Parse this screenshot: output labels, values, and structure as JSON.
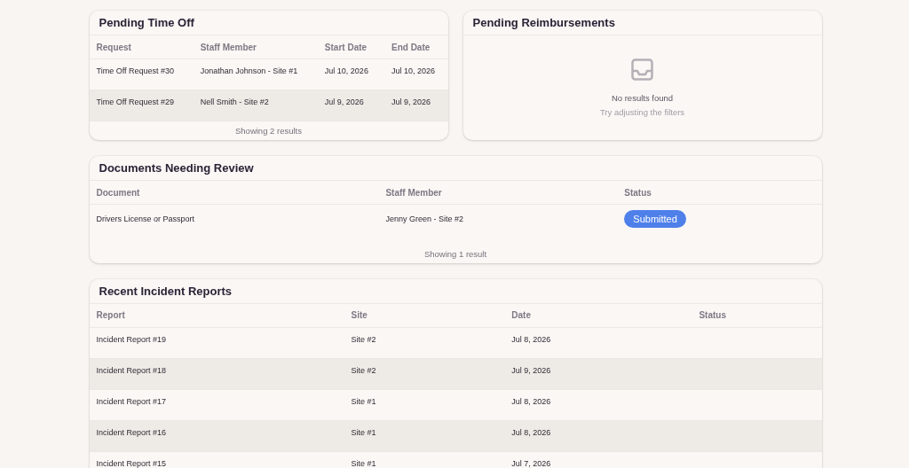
{
  "panels": [
    {
      "kind": "table",
      "title": "Pending Time Off",
      "columns": [
        "Request",
        "Staff Member",
        "Start Date",
        "End Date"
      ],
      "rows": [
        [
          "Time Off Request #30",
          "Jonathan Johnson - Site #1",
          "Jul 10, 2026",
          "Jul 10, 2026"
        ],
        [
          "Time Off Request #29",
          "Nell Smith - Site #2",
          "Jul 9, 2026",
          "Jul 9, 2026"
        ]
      ],
      "footer": "Showing 2 results"
    },
    {
      "kind": "empty",
      "title": "Pending Reimbursements",
      "message": "No results found",
      "hint": "Try adjusting the filters"
    },
    {
      "kind": "table",
      "title": "Documents Needing Review",
      "columns": [
        "Document",
        "Staff Member",
        "Status"
      ],
      "rows": [
        [
          "Drivers License or Passport",
          "Jenny Green - Site #2",
          {
            "badge": "Submitted"
          }
        ]
      ],
      "footer": "Showing 1 result"
    },
    {
      "kind": "table",
      "title": "Recent Incident Reports",
      "columns": [
        "Report",
        "Site",
        "Date",
        "Status"
      ],
      "rows": [
        [
          "Incident Report #19",
          "Site #2",
          "Jul 8, 2026",
          ""
        ],
        [
          "Incident Report #18",
          "Site #2",
          "Jul 9, 2026",
          ""
        ],
        [
          "Incident Report #17",
          "Site #1",
          "Jul 8, 2026",
          ""
        ],
        [
          "Incident Report #16",
          "Site #1",
          "Jul 8, 2026",
          ""
        ],
        [
          "Incident Report #15",
          "Site #1",
          "Jul 7, 2026",
          ""
        ]
      ]
    }
  ]
}
